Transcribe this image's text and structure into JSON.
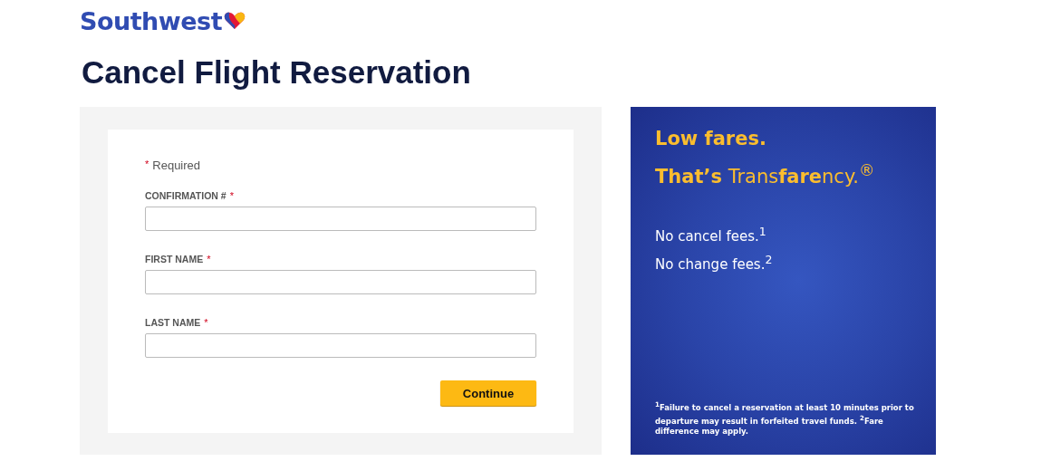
{
  "logo": {
    "text": "Southwest"
  },
  "title": "Cancel Flight Reservation",
  "form": {
    "required_note": {
      "mark": "*",
      "text": "Required"
    },
    "fields": [
      {
        "label": "CONFIRMATION #",
        "mark": "*"
      },
      {
        "label": "FIRST NAME",
        "mark": "*"
      },
      {
        "label": "LAST NAME",
        "mark": "*"
      }
    ],
    "button": "Continue"
  },
  "promo": {
    "headline": [
      "Low fares.",
      "**That’s** Trans**fare**ncy.$^{®}$"
    ],
    "points": [
      "No cancel fees.$^{1}$",
      "No change fees.$^{2}$"
    ],
    "footnote": "$^{1}$Failure to cancel a reservation at least 10 minutes prior to departure may result in forfeited travel funds. $^{2}$Fare difference may apply."
  }
}
